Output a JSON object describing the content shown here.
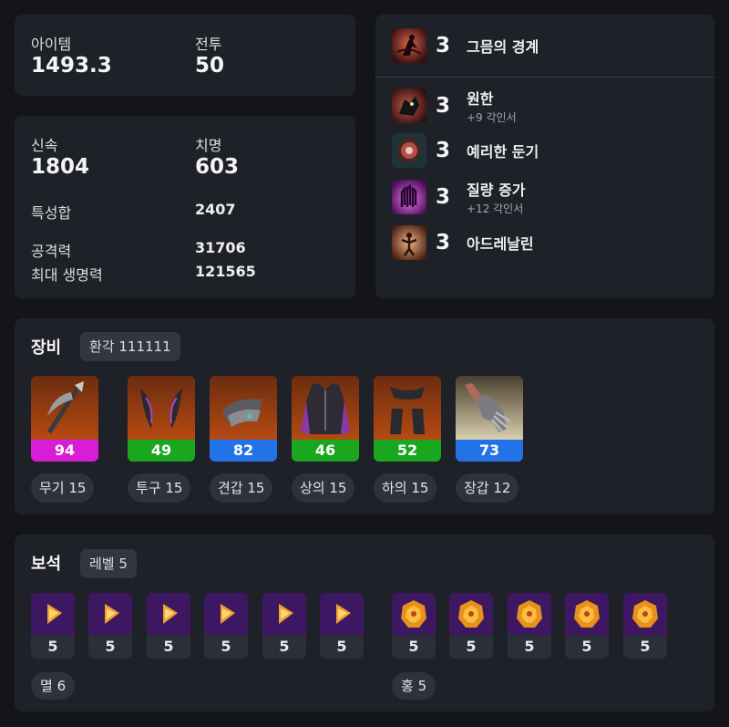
{
  "summary": {
    "item_level_label": "아이템",
    "item_level_value": "1493.3",
    "combat_label": "전투",
    "combat_value": "50"
  },
  "stats": {
    "speed_label": "신속",
    "speed_value": "1804",
    "crit_label": "치명",
    "crit_value": "603",
    "total_label": "특성합",
    "total_value": "2407",
    "attack_label": "공격력",
    "attack_value": "31706",
    "hp_label": "최대 생명력",
    "hp_value": "121565"
  },
  "engravings": {
    "class": {
      "level": "3",
      "name": "그믐의 경계",
      "icon": "shadow-dancer-icon"
    },
    "items": [
      {
        "level": "3",
        "name": "원한",
        "sub": "+9 각인서",
        "icon": "grudge-icon"
      },
      {
        "level": "3",
        "name": "예리한 둔기",
        "sub": "",
        "icon": "keen-blunt-icon"
      },
      {
        "level": "3",
        "name": "질량 증가",
        "sub": "+12 각인서",
        "icon": "mass-increase-icon"
      },
      {
        "level": "3",
        "name": "아드레날린",
        "sub": "",
        "icon": "adrenaline-icon"
      }
    ]
  },
  "equipment": {
    "title": "장비",
    "tag": "환각 111111",
    "items": [
      {
        "label": "무기 15",
        "quality": "94",
        "quality_color": "#d81dd7",
        "icon": "weapon-scythe-icon"
      },
      {
        "label": "투구 15",
        "quality": "49",
        "quality_color": "#1aa61e",
        "icon": "helmet-icon"
      },
      {
        "label": "견갑 15",
        "quality": "82",
        "quality_color": "#2373e8",
        "icon": "shoulder-icon"
      },
      {
        "label": "상의 15",
        "quality": "46",
        "quality_color": "#1aa61e",
        "icon": "chest-armor-icon"
      },
      {
        "label": "하의 15",
        "quality": "52",
        "quality_color": "#1aa61e",
        "icon": "pants-icon"
      },
      {
        "label": "장갑 12",
        "quality": "73",
        "quality_color": "#2373e8",
        "icon": "gloves-icon"
      }
    ]
  },
  "gems": {
    "title": "보석",
    "tag": "레벨 5",
    "annihilation": {
      "levels": [
        "5",
        "5",
        "5",
        "5",
        "5",
        "5"
      ],
      "summary": "멸 6",
      "icon": "annihilation-gem-icon"
    },
    "crimson": {
      "levels": [
        "5",
        "5",
        "5",
        "5",
        "5"
      ],
      "summary": "홍 5",
      "icon": "crimson-gem-icon"
    }
  },
  "colors": {
    "page_bg": "#141519",
    "card_bg": "#1f2128",
    "quality_purple": "#d81dd7",
    "quality_green": "#1aa61e",
    "quality_blue": "#2373e8",
    "gem_bg": "#3e1762"
  }
}
